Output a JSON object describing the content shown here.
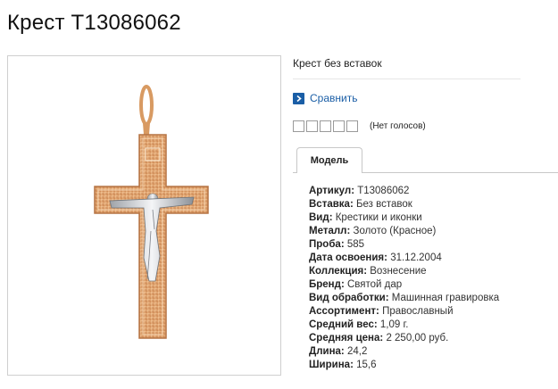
{
  "page": {
    "title": "Крест T13086062"
  },
  "product_image": {
    "alt": "крест"
  },
  "info": {
    "subtitle": "Крест без вставок",
    "compare_label": "Сравнить",
    "compare_icon": "chevron-right-icon",
    "rating": {
      "stars": 5,
      "votes_label": "(Нет голосов)"
    },
    "tab_label": "Модель"
  },
  "specs": [
    {
      "label": "Артикул",
      "value": "T13086062"
    },
    {
      "label": "Вставка",
      "value": "Без вставок"
    },
    {
      "label": "Вид",
      "value": "Крестики и иконки"
    },
    {
      "label": "Металл",
      "value": "Золото (Красное)"
    },
    {
      "label": "Проба",
      "value": "585"
    },
    {
      "label": "Дата освоения",
      "value": "31.12.2004"
    },
    {
      "label": "Коллекция",
      "value": "Вознесение"
    },
    {
      "label": "Бренд",
      "value": "Святой дар"
    },
    {
      "label": "Вид обработки",
      "value": "Машинная гравировка"
    },
    {
      "label": "Ассортимент",
      "value": "Православный"
    },
    {
      "label": "Средний вес",
      "value": "1,09 г."
    },
    {
      "label": "Средняя цена",
      "value": "2 250,00 руб."
    },
    {
      "label": "Длина",
      "value": "24,2"
    },
    {
      "label": "Ширина",
      "value": "15,6"
    }
  ],
  "colors": {
    "link": "#1a5ea6",
    "gold": "#e0a86e",
    "silver": "#cfd2d6"
  }
}
